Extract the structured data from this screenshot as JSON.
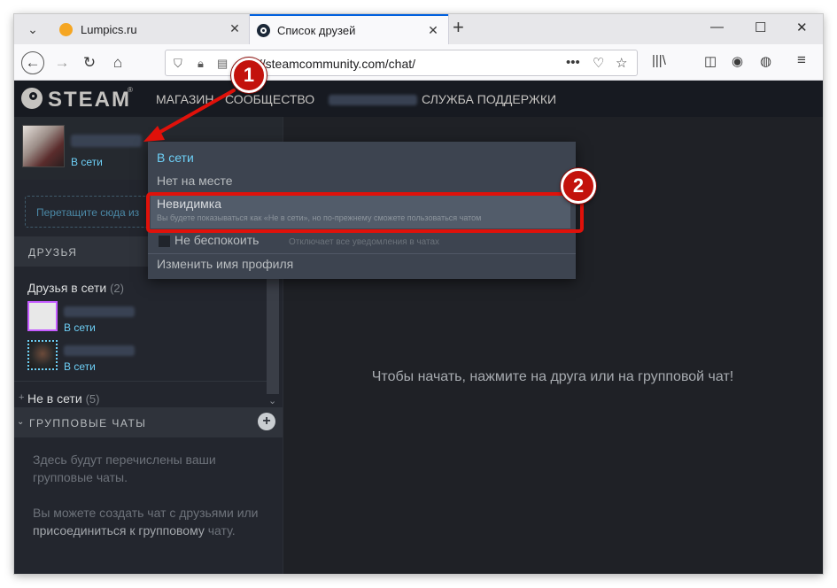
{
  "browser": {
    "tabs": [
      {
        "title": "Lumpics.ru",
        "active": false
      },
      {
        "title": "Список друзей",
        "active": true
      }
    ],
    "url": "https://steamcommunity.com/chat/",
    "url_visible": "s://steamcommunity.com/chat/"
  },
  "steam_nav": {
    "logo_text": "STEAM",
    "items": [
      "МАГАЗИН",
      "СООБЩЕСТВО",
      "СЛУЖБА ПОДДЕРЖКИ"
    ]
  },
  "me": {
    "status": "В сети"
  },
  "sidebar": {
    "drop_hint": "Перетащите сюда из",
    "friends_header": "ДРУЗЬЯ",
    "online_group": "Друзья в сети",
    "online_count": "(2)",
    "friends": [
      {
        "status": "В сети"
      },
      {
        "status": "В сети"
      }
    ],
    "offline_group": "Не в сети",
    "offline_count": "(5)",
    "group_chats_header": "ГРУППОВЫЕ ЧАТЫ",
    "group_chats_text1": "Здесь будут перечислены ваши групповые чаты.",
    "group_chats_text2_a": "Вы можете создать чат с друзьями или",
    "group_chats_text2_link": "присоединиться к групповому",
    "group_chats_text2_b": "чату."
  },
  "main": {
    "empty_message": "Чтобы начать, нажмите на друга или на групповой чат!"
  },
  "status_menu": {
    "online": "В сети",
    "away": "Нет на месте",
    "invisible": "Невидимка",
    "invisible_desc": "Вы будете показываться как «Не в сети», но по-прежнему сможете пользоваться чатом",
    "dnd": "Не беспокоить",
    "dnd_desc": "Отключает все уведомления в чатах",
    "change_name": "Изменить имя профиля"
  },
  "annotations": [
    {
      "label": "1"
    },
    {
      "label": "2"
    }
  ],
  "colors": {
    "accent_online": "#6dcff6",
    "annotation_red": "#c3120c",
    "steam_header": "#171a21"
  }
}
